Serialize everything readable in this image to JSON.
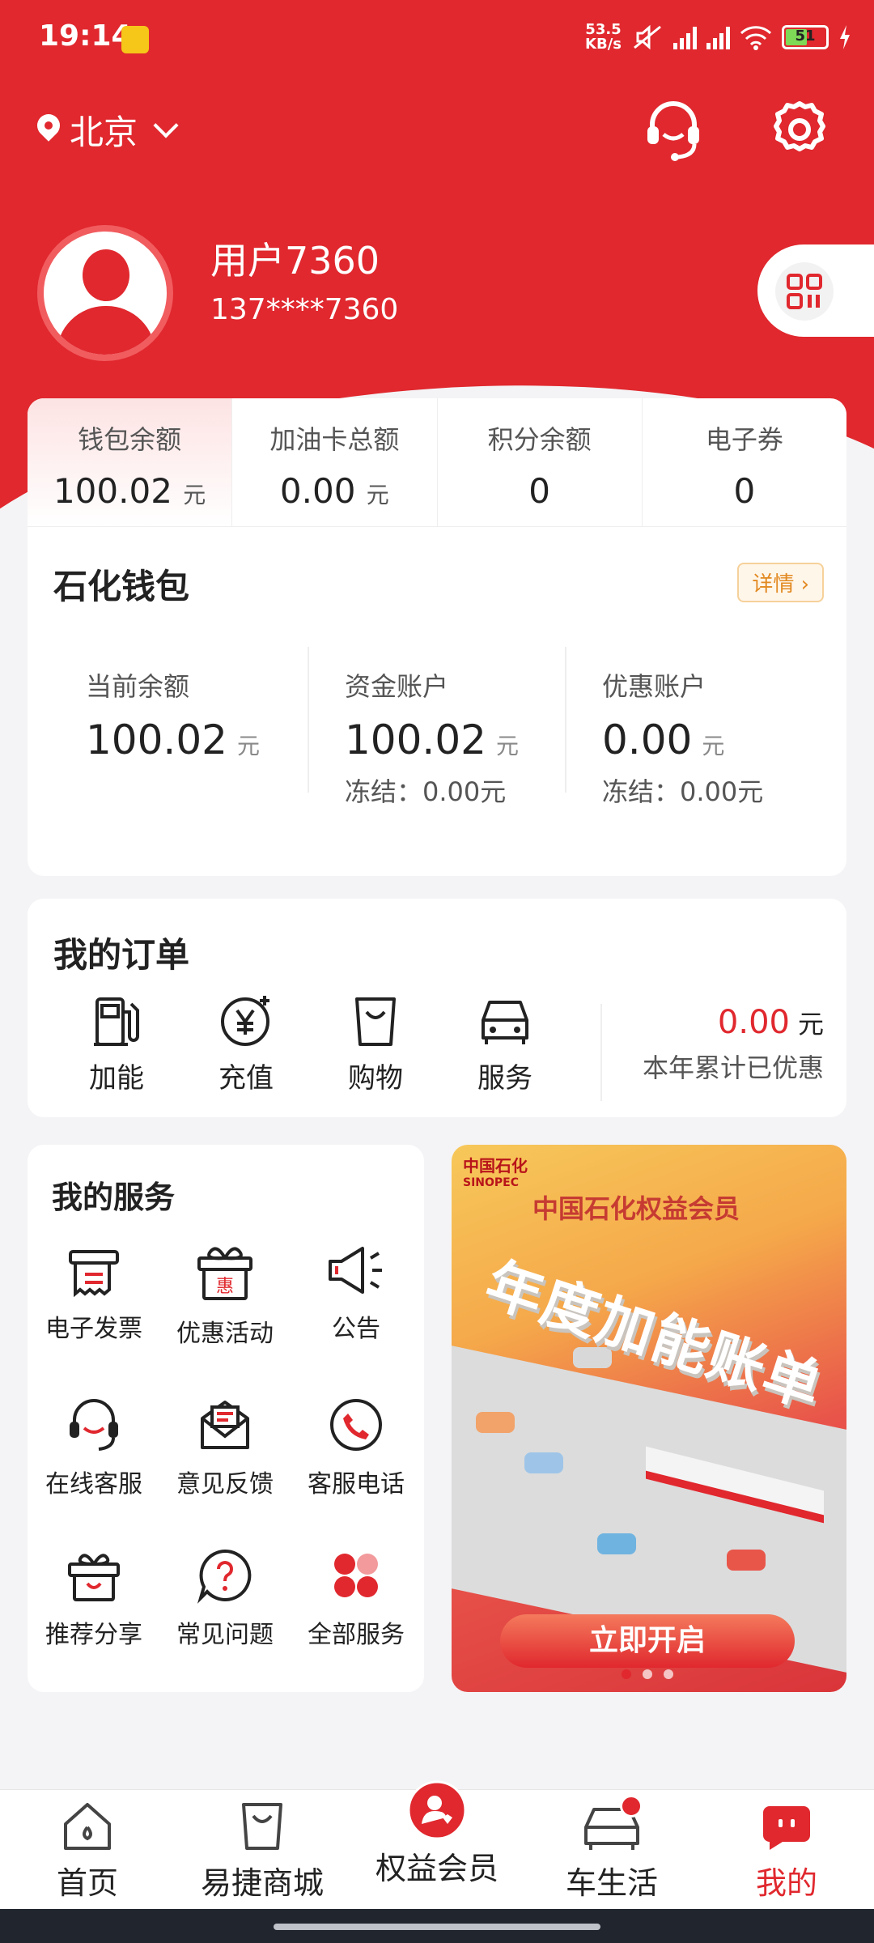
{
  "status_bar": {
    "time": "19:14",
    "net_speed_top": "53.5",
    "net_speed_bottom": "KB/s",
    "battery": "51"
  },
  "header": {
    "city": "北京",
    "user_name": "用户7360",
    "phone": "137****7360"
  },
  "balance_tabs": [
    {
      "label": "钱包余额",
      "value": "100.02",
      "unit": "元"
    },
    {
      "label": "加油卡总额",
      "value": "0.00",
      "unit": "元"
    },
    {
      "label": "积分余额",
      "value": "0",
      "unit": ""
    },
    {
      "label": "电子券",
      "value": "0",
      "unit": ""
    }
  ],
  "wallet": {
    "title": "石化钱包",
    "detail_label": "详情",
    "cols": [
      {
        "label": "当前余额",
        "value": "100.02",
        "unit": "元",
        "frozen": ""
      },
      {
        "label": "资金账户",
        "value": "100.02",
        "unit": "元",
        "frozen": "冻结：0.00元"
      },
      {
        "label": "优惠账户",
        "value": "0.00",
        "unit": "元",
        "frozen": "冻结：0.00元"
      }
    ]
  },
  "orders": {
    "title": "我的订单",
    "items": [
      {
        "label": "加能"
      },
      {
        "label": "充值"
      },
      {
        "label": "购物"
      },
      {
        "label": "服务"
      }
    ],
    "saved_value": "0.00",
    "saved_unit": "元",
    "saved_label": "本年累计已优惠"
  },
  "services": {
    "title": "我的服务",
    "items": [
      {
        "label": "电子发票",
        "icon": "invoice-icon"
      },
      {
        "label": "优惠活动",
        "icon": "gift-box-icon"
      },
      {
        "label": "公告",
        "icon": "megaphone-icon"
      },
      {
        "label": "在线客服",
        "icon": "headset-icon"
      },
      {
        "label": "意见反馈",
        "icon": "feedback-icon"
      },
      {
        "label": "客服电话",
        "icon": "phone-icon"
      },
      {
        "label": "推荐分享",
        "icon": "gift-icon"
      },
      {
        "label": "常见问题",
        "icon": "question-icon"
      },
      {
        "label": "全部服务",
        "icon": "all-services-icon"
      }
    ],
    "gift_box_text": "惠"
  },
  "banner": {
    "logo_cn": "中国石化",
    "logo_en": "SINOPEC",
    "subtitle": "中国石化权益会员",
    "headline": "年度加能账单",
    "cta": "立即开启"
  },
  "bottom_nav": [
    {
      "label": "首页",
      "icon": "home-icon"
    },
    {
      "label": "易捷商城",
      "icon": "bag-icon"
    },
    {
      "label": "权益会员",
      "icon": "member-icon"
    },
    {
      "label": "车生活",
      "icon": "car-icon"
    },
    {
      "label": "我的",
      "icon": "profile-icon"
    }
  ],
  "colors": {
    "brand_red": "#e0282e",
    "accent_orange": "#e28a22",
    "background": "#f4f4f6"
  }
}
